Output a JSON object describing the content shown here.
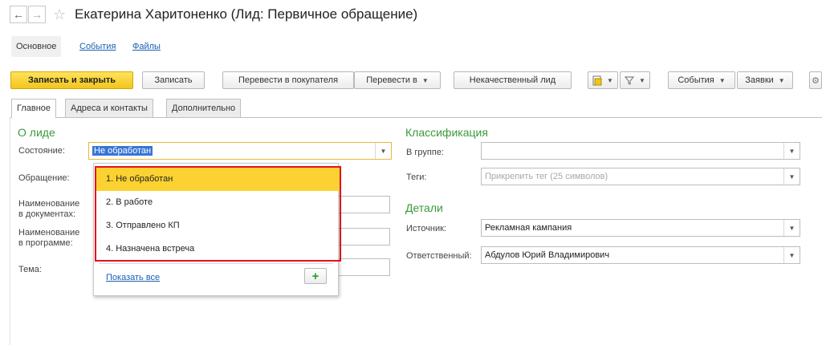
{
  "window": {
    "title": "Екатерина Харитоненко (Лид: Первичное обращение)",
    "back_glyph": "←",
    "forward_glyph": "→",
    "star_glyph": "☆"
  },
  "sections": {
    "main": "Основное",
    "events": "События",
    "files": "Файлы"
  },
  "toolbar": {
    "save_close": "Записать и закрыть",
    "save": "Записать",
    "to_customer": "Перевести в покупателя",
    "to_menu": "Перевести в",
    "bad_lead": "Некачественный лид",
    "events_menu": "События",
    "requests_menu": "Заявки",
    "gear_glyph": "⚙"
  },
  "tabs": {
    "main": "Главное",
    "addresses": "Адреса и контакты",
    "extra": "Дополнительно"
  },
  "about": {
    "title": "О лиде",
    "state_label": "Состояние:",
    "state_value": "Не обработан",
    "appeal_label": "Обращение:",
    "doc_name_label_1": "Наименование",
    "doc_name_label_2": "в документах:",
    "prog_name_label_1": "Наименование",
    "prog_name_label_2": "в программе:",
    "topic_label": "Тема:"
  },
  "state_popup": {
    "items": [
      "1. Не обработан",
      "2. В работе",
      "3. Отправлено КП",
      "4. Назначена встреча"
    ],
    "show_all": "Показать все",
    "add_glyph": "+",
    "highlight_color": "#e3131b",
    "selected_color": "#fbd231"
  },
  "classification": {
    "title": "Классификация",
    "group_label": "В группе:",
    "group_value": "",
    "tags_label": "Теги:",
    "tags_placeholder": "Прикрепить тег (25 символов)"
  },
  "details": {
    "title": "Детали",
    "source_label": "Источник:",
    "source_value": "Рекламная кампания",
    "responsible_label": "Ответственный:",
    "responsible_value": "Абдулов Юрий Владимирович"
  },
  "colors": {
    "primary_button": "#f2c51c",
    "group_title": "#3a9a3a",
    "link": "#1a5fb4"
  }
}
